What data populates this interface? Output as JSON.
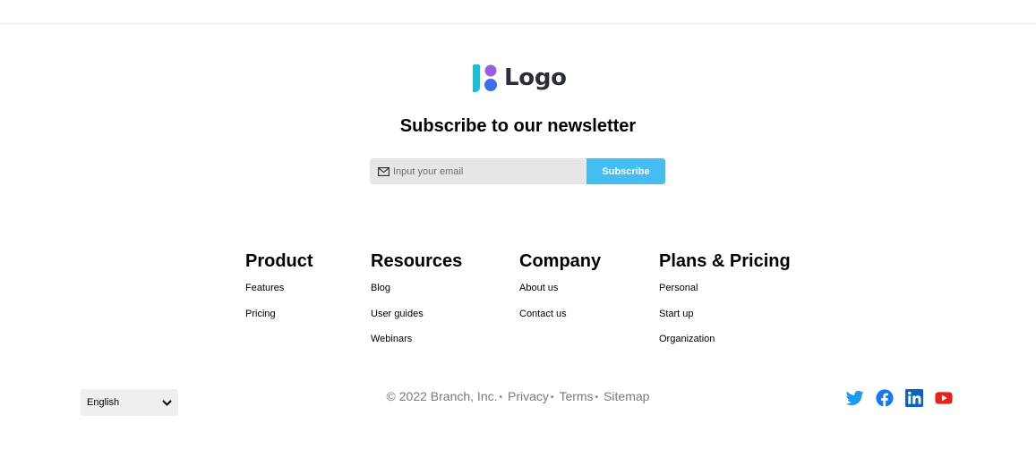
{
  "logo": {
    "text": "Logo",
    "icon": "logo-mark-icon"
  },
  "newsletter": {
    "title": "Subscribe to our newsletter",
    "email_placeholder": "Input your email",
    "email_value": "",
    "subscribe_label": "Subscribe",
    "icon": "mail-icon"
  },
  "columns": [
    {
      "title": "Product",
      "links": [
        "Features",
        "Pricing"
      ]
    },
    {
      "title": "Resources",
      "links": [
        "Blog",
        "User guides",
        "Webinars"
      ]
    },
    {
      "title": "Company",
      "links": [
        "About us",
        "Contact us"
      ]
    },
    {
      "title": "Plans & Pricing",
      "links": [
        "Personal",
        "Start up",
        "Organization"
      ]
    }
  ],
  "language": {
    "selected": "English",
    "icon": "chevron-down-icon"
  },
  "legal": {
    "copyright": "© 2022 Branch, Inc.",
    "privacy": "Privacy",
    "terms": "Terms",
    "sitemap": "Sitemap",
    "separator": "•"
  },
  "social": [
    {
      "name": "twitter-icon",
      "color": "#1d9bf0"
    },
    {
      "name": "facebook-icon",
      "color": "#1877f2"
    },
    {
      "name": "linkedin-icon",
      "color": "#0a66c2"
    },
    {
      "name": "youtube-icon",
      "color": "#e62117"
    }
  ],
  "colors": {
    "accent": "#44bdf3",
    "input_bg": "#e6e6e6",
    "muted_text": "#7a7a7a"
  }
}
